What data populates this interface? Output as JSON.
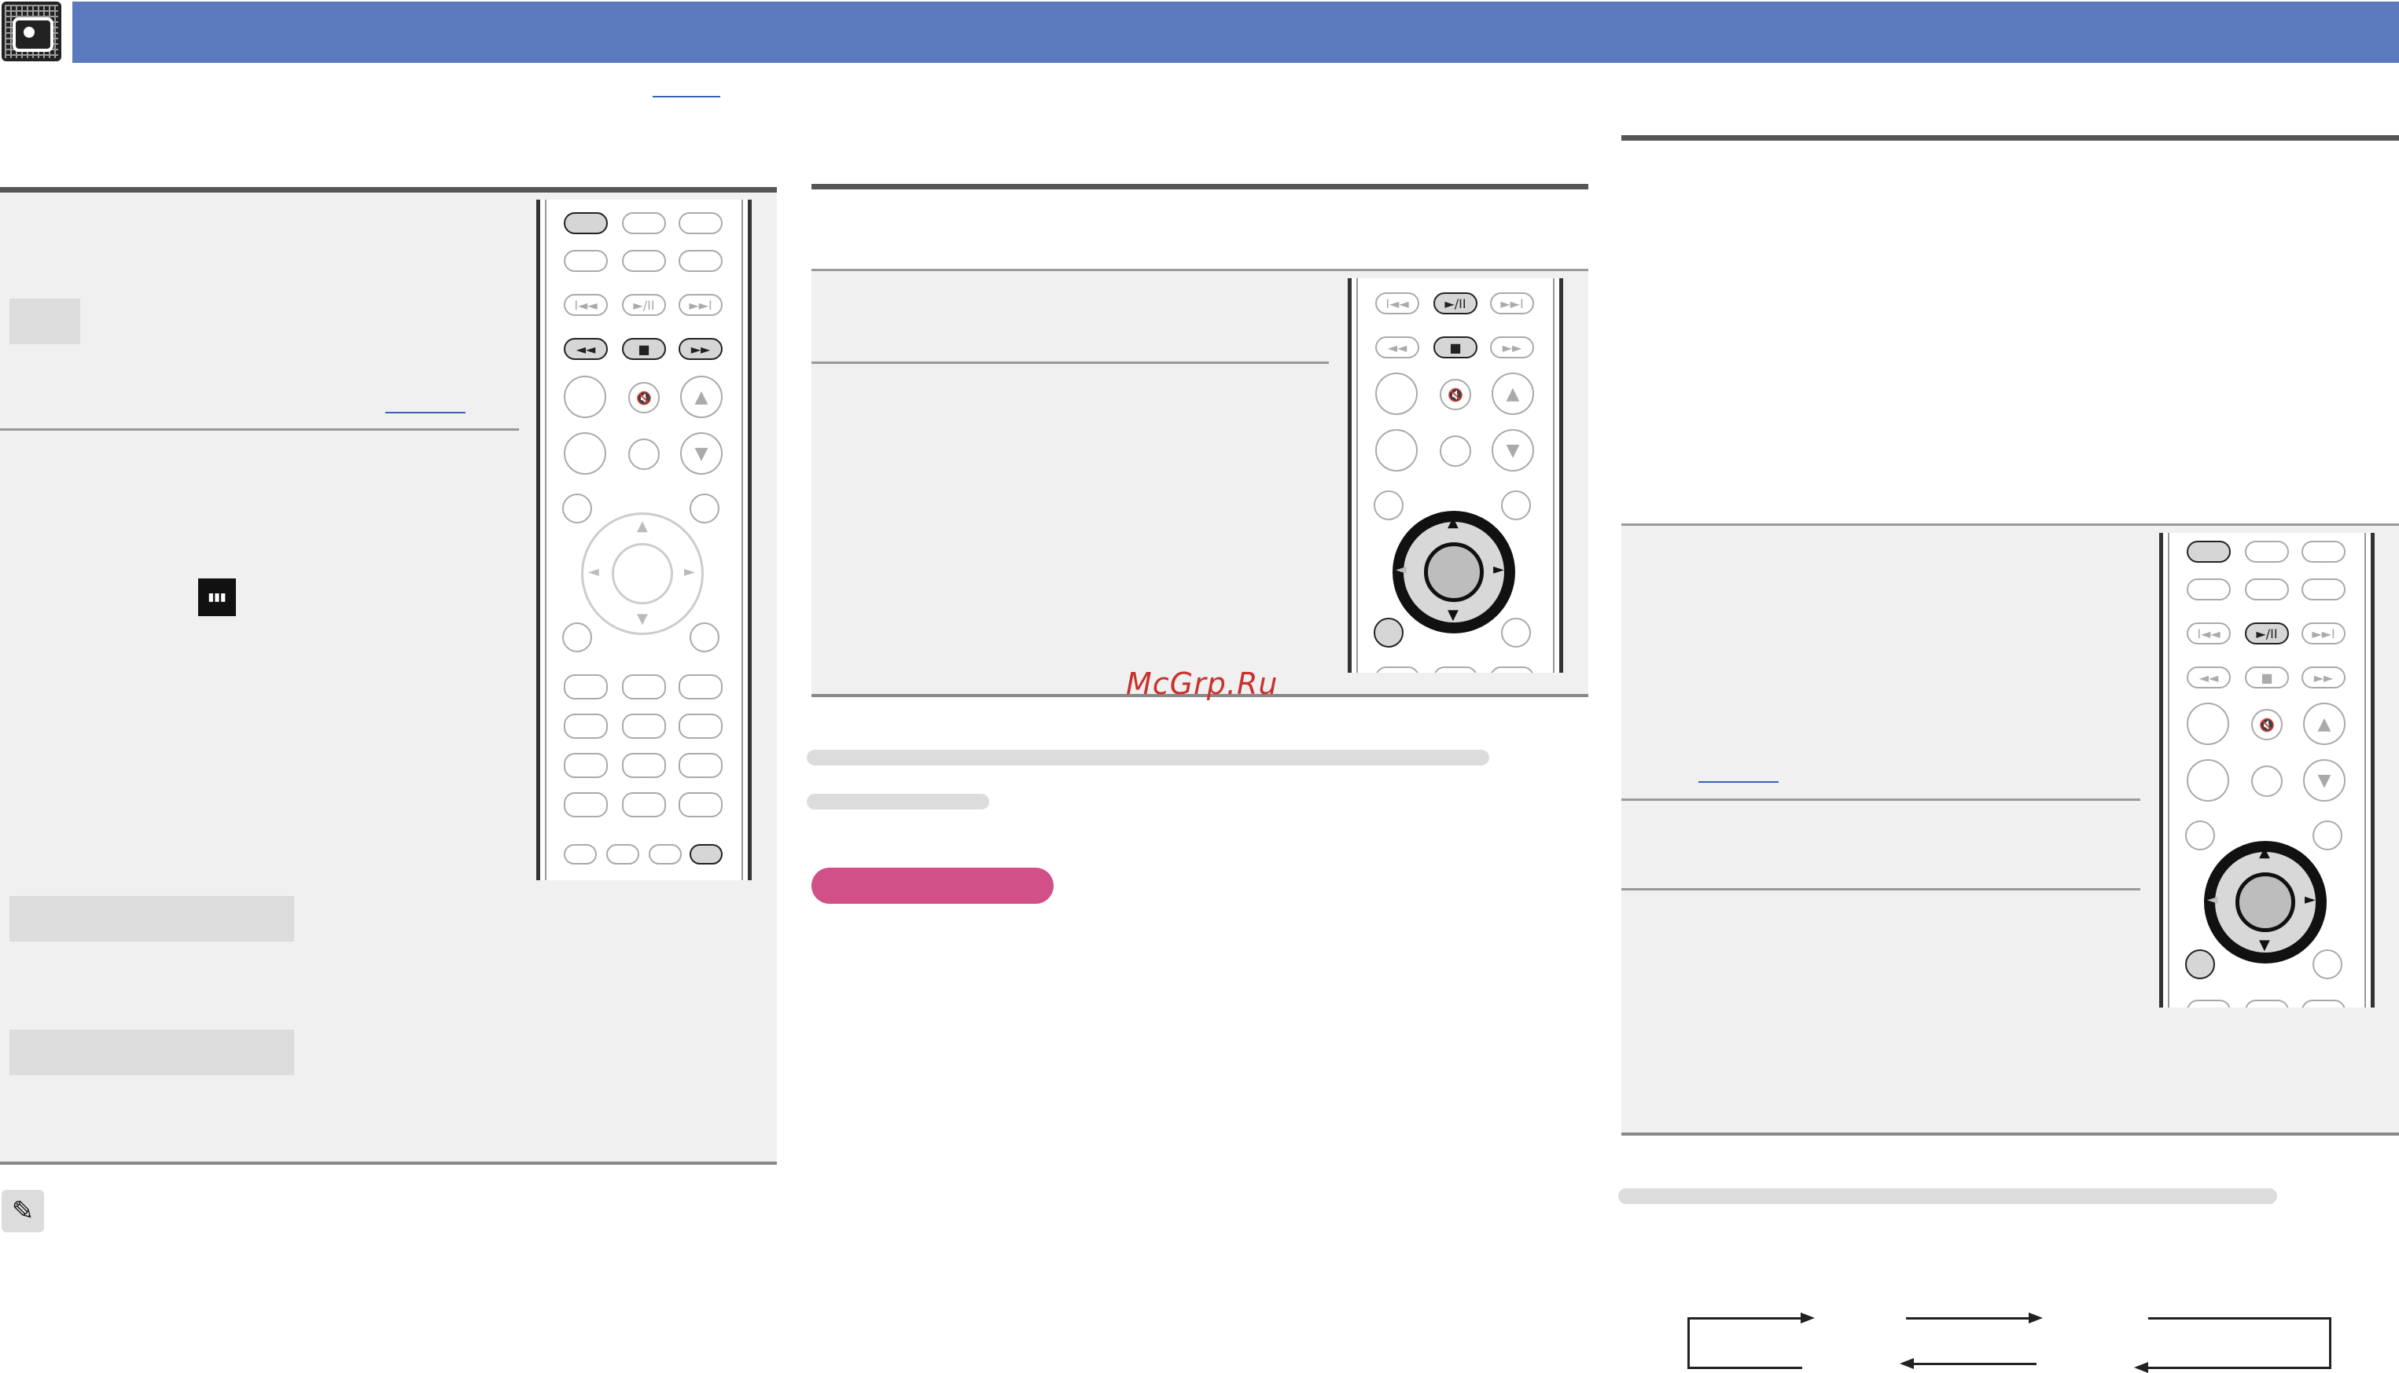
{
  "header": {
    "logo_icon": "speaker-grid-icon",
    "banner_color": "#5a7abd"
  },
  "remote_labels": {
    "play_pause": "►/II",
    "stop": "■",
    "rewind": "◄◄",
    "fast_forward": "►►",
    "skip_back": "I◄◄",
    "skip_forward": "►►I",
    "vol_up": "▲",
    "vol_down": "▼",
    "mute": "🔇",
    "up": "▲",
    "down": "▼",
    "left": "◄",
    "right": "►"
  },
  "watermark": "McGrp.Ru",
  "icons": {
    "note": "pencil-icon",
    "equalizer": "equalizer-icon"
  },
  "colors": {
    "accent_pill": "#d15088",
    "watermark": "#c8322e"
  }
}
